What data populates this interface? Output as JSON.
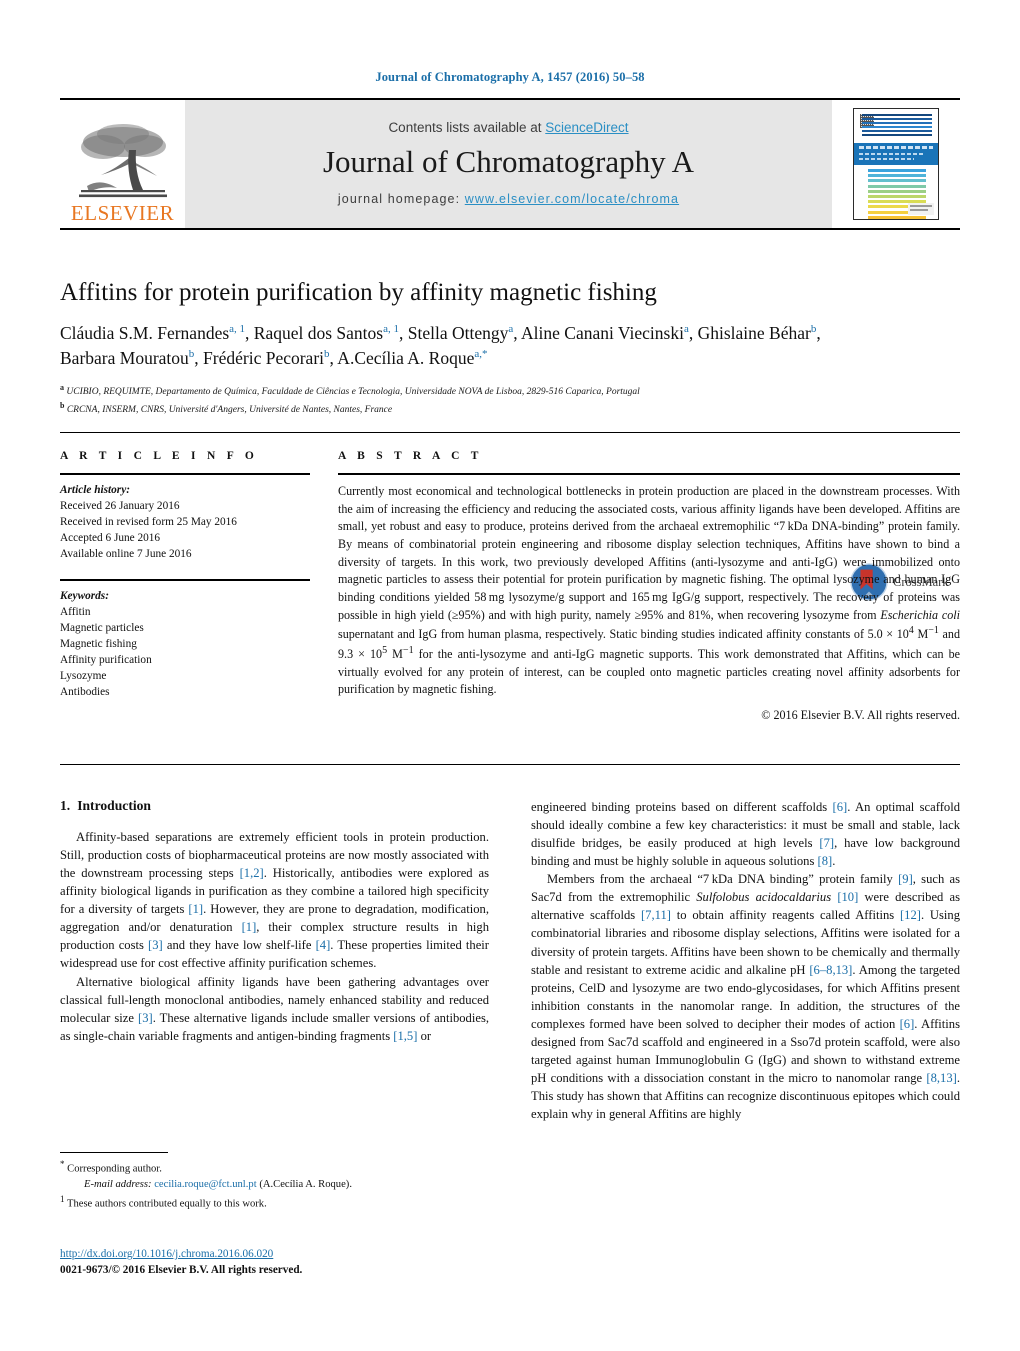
{
  "running_head": "Journal of Chromatography A, 1457 (2016) 50–58",
  "masthead": {
    "contents_prefix": "Contents lists available at ",
    "sciencedirect": "ScienceDirect",
    "journal_title": "Journal of Chromatography A",
    "homepage_prefix": "journal homepage: ",
    "homepage_url": "www.elsevier.com/locate/chroma",
    "publisher": "ELSEVIER",
    "cover_title": "JOURNAL OF CHROMATOGRAPHY A",
    "accent_blue": "#2b8fc4",
    "elsevier_orange": "#E87722"
  },
  "article": {
    "title": "Affitins for protein purification by affinity magnetic fishing",
    "crossmark_label": "CrossMark",
    "authors_line_1": "Cláudia S.M. Fernandes",
    "authors_html": "Cláudia S.M. Fernandes<sup>a, 1</sup>, Raquel dos Santos<sup>a, 1</sup>, Stella Ottengy<sup>a</sup>, Aline Canani Viecinski<sup>a</sup>, Ghislaine Béhar<sup>b</sup>, Barbara Mouratou<sup>b</sup>, Frédéric Pecorari<sup>b</sup>, A.Cecília A. Roque<sup>a,*</sup>",
    "affiliation_a": "UCIBIO, REQUIMTE, Departamento de Química, Faculdade de Ciências e Tecnologia, Universidade NOVA de Lisboa, 2829-516 Caparica, Portugal",
    "affiliation_b": "CRCNA, INSERM, CNRS, Université d'Angers, Université de Nantes, Nantes, France",
    "affiliation_a_mark": "a",
    "affiliation_b_mark": "b"
  },
  "article_info": {
    "heading": "A R T I C L E    I N F O",
    "history_label": "Article history:",
    "history": [
      "Received 26 January 2016",
      "Received in revised form 25 May 2016",
      "Accepted 6 June 2016",
      "Available online 7 June 2016"
    ],
    "keywords_label": "Keywords:",
    "keywords": [
      "Affitin",
      "Magnetic particles",
      "Magnetic fishing",
      "Affinity purification",
      "Lysozyme",
      "Antibodies"
    ]
  },
  "abstract": {
    "heading": "A B S T R A C T",
    "body_html": "Currently most economical and technological bottlenecks in protein production are placed in the downstream processes. With the aim of increasing the efficiency and reducing the associated costs, various affinity ligands have been developed. Affitins are small, yet robust and easy to produce, proteins derived from the archaeal extremophilic &ldquo;7&thinsp;kDa DNA-binding&rdquo; protein family. By means of combinatorial protein engineering and ribosome display selection techniques, Affitins have shown to bind a diversity of targets. In this work, two previously developed Affitins (anti-lysozyme and anti-IgG) were immobilized onto magnetic particles to assess their potential for protein purification by magnetic fishing. The optimal lysozyme and human IgG binding conditions yielded 58&thinsp;mg lysozyme/g support and 165&thinsp;mg IgG/g support, respectively. The recovery of proteins was possible in high yield (&ge;95%) and with high purity, namely &ge;95% and 81%, when recovering lysozyme from <span class=\"ital\">Escherichia coli</span> supernatant and IgG from human plasma, respectively. Static binding studies indicated affinity constants of 5.0 &times; 10<sup>4</sup> M<sup>&minus;1</sup> and 9.3 &times; 10<sup>5</sup> M<sup>&minus;1</sup> for the anti-lysozyme and anti-IgG magnetic supports. This work demonstrated that Affitins, which can be virtually evolved for any protein of interest, can be coupled onto magnetic particles creating novel affinity adsorbents for purification by magnetic fishing.",
    "copyright": "© 2016 Elsevier B.V. All rights reserved."
  },
  "body": {
    "section_number": "1.",
    "section_title": "Introduction",
    "left_paragraphs_html": [
      "Affinity-based separations are extremely efficient tools in protein production. Still, production costs of biopharmaceutical proteins are now mostly associated with the downstream processing steps <span class=\"ref\">[1,2]</span>. Historically, antibodies were explored as affinity biological ligands in purification as they combine a tailored high specificity for a diversity of targets <span class=\"ref\">[1]</span>. However, they are prone to degradation, modification, aggregation and/or denaturation <span class=\"ref\">[1]</span>, their complex structure results in high production costs <span class=\"ref\">[3]</span> and they have low shelf-life <span class=\"ref\">[4]</span>. These properties limited their widespread use for cost effective affinity purification schemes.",
      "Alternative biological affinity ligands have been gathering advantages over classical full-length monoclonal antibodies, namely enhanced stability and reduced molecular size <span class=\"ref\">[3]</span>. These alternative ligands include smaller versions of antibodies, as single-chain variable fragments and antigen-binding fragments <span class=\"ref\">[1,5]</span> or"
    ],
    "right_paragraphs_html": [
      "engineered binding proteins based on different scaffolds <span class=\"ref\">[6]</span>. An optimal scaffold should ideally combine a few key characteristics: it must be small and stable, lack disulfide bridges, be easily produced at high levels <span class=\"ref\">[7]</span>, have low background binding and must be highly soluble in aqueous solutions <span class=\"ref\">[8]</span>.",
      "Members from the archaeal &ldquo;7&thinsp;kDa DNA binding&rdquo; protein family <span class=\"ref\">[9]</span>, such as Sac7d from the extremophilic <span class=\"ital\">Sulfolobus acidocaldarius</span> <span class=\"ref\">[10]</span> were described as alternative scaffolds <span class=\"ref\">[7,11]</span> to obtain affinity reagents called Affitins <span class=\"ref\">[12]</span>. Using combinatorial libraries and ribosome display selections, Affitins were isolated for a diversity of protein targets. Affitins have been shown to be chemically and thermally stable and resistant to extreme acidic and alkaline pH <span class=\"ref\">[6&ndash;8,13]</span>. Among the targeted proteins, CelD and lysozyme are two endo-glycosidases, for which Affitins present inhibition constants in the nanomolar range. In addition, the structures of the complexes formed have been solved to decipher their modes of action <span class=\"ref\">[6]</span>. Affitins designed from Sac7d scaffold and engineered in a Sso7d protein scaffold, were also targeted against human Immunoglobulin G (IgG) and shown to withstand extreme pH conditions with a dissociation constant in the micro to nanomolar range <span class=\"ref\">[8,13]</span>. This study has shown that Affitins can recognize discontinuous epitopes which could explain why in general Affitins are highly"
    ]
  },
  "footnotes": {
    "corresponding_mark": "*",
    "corresponding_text": "Corresponding author.",
    "email_label": "E-mail address:",
    "email": "cecilia.roque@fct.unl.pt",
    "email_owner": "(A.Cecília A. Roque).",
    "equal_mark": "1",
    "equal_text": "These authors contributed equally to this work."
  },
  "doi_block": {
    "doi_url": "http://dx.doi.org/10.1016/j.chroma.2016.06.020",
    "issn_line": "0021-9673/© 2016 Elsevier B.V. All rights reserved."
  }
}
